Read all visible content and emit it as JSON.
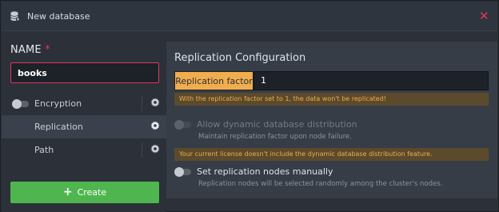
{
  "header": {
    "title": "New database",
    "icon": "database-add-icon",
    "close_icon": "close-icon"
  },
  "left": {
    "name_label": "NAME",
    "required_mark": "*",
    "name_value": "books",
    "menu": [
      {
        "label": "Encryption",
        "toggle": "off",
        "icon": "gear-icon"
      },
      {
        "label": "Replication",
        "active": true,
        "icon": "gear-icon"
      },
      {
        "label": "Path",
        "icon": "gear-icon"
      }
    ],
    "create_label": "Create",
    "create_icon": "plus-icon"
  },
  "replication": {
    "title": "Replication Configuration",
    "factor_label": "Replication factor",
    "factor_value": "1",
    "factor_warning": "With the replication factor set to 1, the data won't be replicated!",
    "dynamic": {
      "title": "Allow dynamic database distribution",
      "desc": "Maintain replication factor upon node failure.",
      "enabled": false
    },
    "license_warning": "Your current license doesn't include the dynamic database distribution feature.",
    "manual_nodes": {
      "title": "Set replication nodes manually",
      "desc": "Replication nodes will be selected randomly among the cluster's nodes.",
      "toggle": "off"
    }
  },
  "colors": {
    "accent_required": "#e2365a",
    "create_green": "#4fb64f",
    "warning_orange": "#f0ad4e"
  }
}
